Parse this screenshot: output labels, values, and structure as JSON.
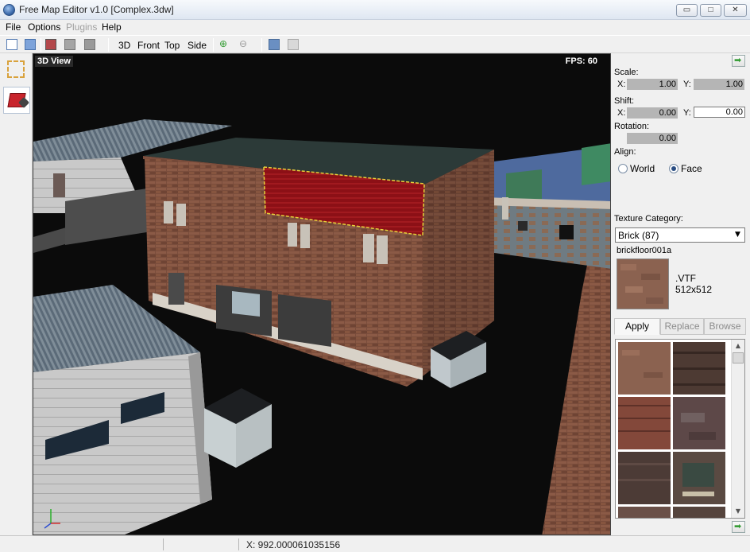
{
  "window": {
    "title": "Free Map Editor v1.0 [Complex.3dw]",
    "min_glyph": "▭",
    "max_glyph": "□",
    "close_glyph": "✕"
  },
  "menu": {
    "items": [
      "File",
      "Options",
      "Plugins",
      "Help"
    ]
  },
  "toolbar": {
    "views": [
      "3D",
      "Front",
      "Top",
      "Side"
    ]
  },
  "viewport": {
    "label": "3D View",
    "fps": "FPS: 60"
  },
  "panel": {
    "scale_label": "Scale:",
    "scale_x_axis": "X:",
    "scale_y_axis": "Y:",
    "scale_x": "1.00",
    "scale_y": "1.00",
    "shift_label": "Shift:",
    "shift_x_axis": "X:",
    "shift_y_axis": "Y:",
    "shift_x": "0.00",
    "shift_y": "0.00",
    "rotation_label": "Rotation:",
    "rotation": "0.00",
    "align_label": "Align:",
    "align_world": "World",
    "align_face": "Face",
    "texture_category_label": "Texture Category:",
    "texture_category": "Brick (87)",
    "texture_name": "brickfloor001a",
    "texture_format": ".VTF",
    "texture_size": "512x512",
    "tabs": [
      "Apply",
      "Replace",
      "Browse"
    ]
  },
  "statusbar": {
    "coord": "X: 992.000061035156"
  },
  "colors": {
    "viewport_bg": "#0b0b0b",
    "selection_highlight": "#8c1016",
    "selection_outline": "#e8d23a",
    "brick": "#7a4d3c",
    "accent_green": "#2f9a2f"
  }
}
